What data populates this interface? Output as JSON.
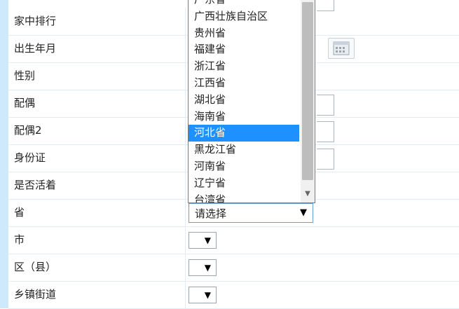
{
  "form": {
    "rows": [
      {
        "label": "家中排行"
      },
      {
        "label": "出生年月"
      },
      {
        "label": "性别"
      },
      {
        "label": "配偶"
      },
      {
        "label": "配偶2"
      },
      {
        "label": "身份证"
      },
      {
        "label": "是否活着"
      },
      {
        "label": "省"
      },
      {
        "label": "市"
      },
      {
        "label": "区（县）"
      },
      {
        "label": "乡镇街道"
      }
    ]
  },
  "province_select": {
    "selected_text": "请选择",
    "arrow": "▼",
    "options": [
      "广东省",
      "广西壮族自治区",
      "贵州省",
      "福建省",
      "浙江省",
      "江西省",
      "湖北省",
      "海南省",
      "河北省",
      "黑龙江省",
      "河南省",
      "辽宁省",
      "台湾省"
    ],
    "highlighted": "河北省"
  },
  "city_select": {
    "arrow": "▼"
  },
  "district_select": {
    "arrow": "▼"
  },
  "town_select": {
    "arrow": "▼"
  },
  "colors": {
    "left_strip": "#cde9fb",
    "highlight": "#1e90ff",
    "row_border": "#e3ebf3"
  },
  "icons": {
    "calendar": "calendar-icon",
    "scroll_down": "scroll-down-arrow-icon"
  }
}
